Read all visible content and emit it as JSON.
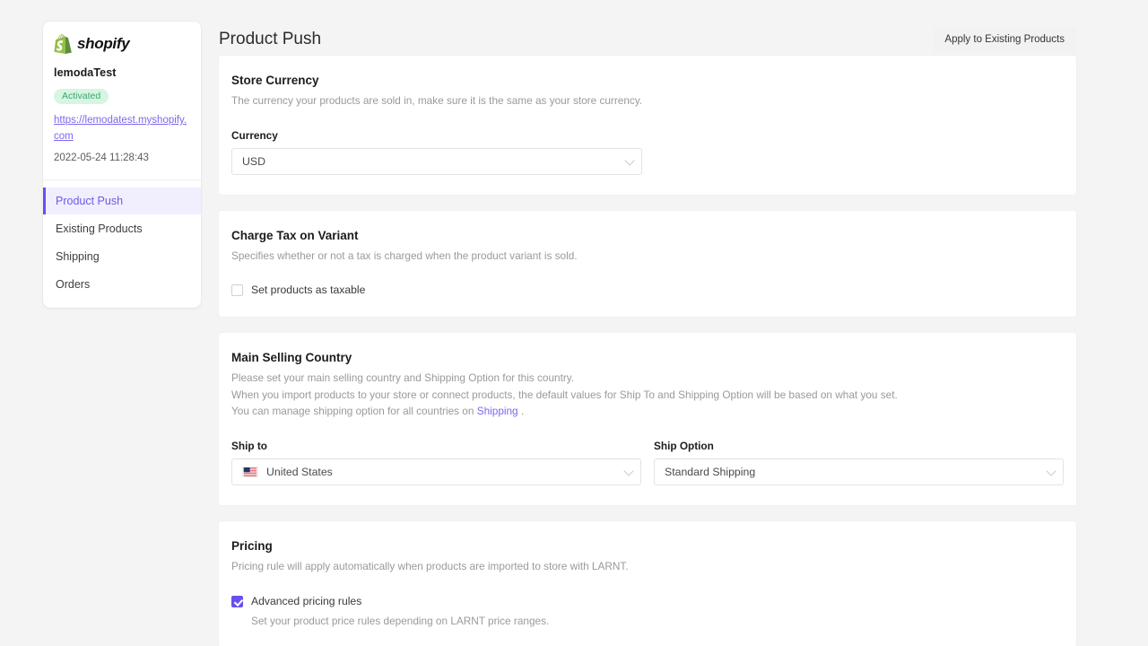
{
  "sidebar": {
    "logo_text": "shopify",
    "logo_icon": "shopify-bag-icon",
    "store_name": "lemodaTest",
    "status_badge": "Activated",
    "store_url": "https://lemodatest.myshopify.com",
    "timestamp": "2022-05-24 11:28:43",
    "nav_items": [
      {
        "label": "Product Push",
        "active": true
      },
      {
        "label": "Existing Products",
        "active": false
      },
      {
        "label": "Shipping",
        "active": false
      },
      {
        "label": "Orders",
        "active": false
      }
    ]
  },
  "header": {
    "title": "Product Push",
    "apply_button": "Apply to Existing Products"
  },
  "cards": {
    "store_currency": {
      "title": "Store Currency",
      "description": "The currency your products are sold in, make sure it is the same as your store currency.",
      "field_label": "Currency",
      "value": "USD"
    },
    "charge_tax": {
      "title": "Charge Tax on Variant",
      "description": "Specifies whether or not a tax is charged when the product variant is sold.",
      "checkbox_label": "Set products as taxable",
      "checked": false
    },
    "main_selling_country": {
      "title": "Main Selling Country",
      "description_line1": "Please set your main selling country and Shipping Option for this country.",
      "description_line2": "When you import products to your store or connect products, the default values for Ship To and Shipping Option will be based on what you set.",
      "description_line3_pre": "You can manage shipping option for all countries on ",
      "description_link": "Shipping",
      "description_line3_post": " .",
      "ship_to_label": "Ship to",
      "ship_to_value": "United States",
      "ship_to_flag": "us-flag-icon",
      "ship_option_label": "Ship Option",
      "ship_option_value": "Standard Shipping"
    },
    "pricing": {
      "title": "Pricing",
      "description": "Pricing rule will apply automatically when products are imported to store with LARNT.",
      "checkbox_label": "Advanced pricing rules",
      "checked": true,
      "sub_description": "Set your product price rules depending on LARNT price ranges."
    }
  },
  "colors": {
    "accent_purple": "#6b4ef0",
    "link_purple": "#7b68ee",
    "badge_green": "#3aa86b",
    "shopify_green": "#95bf47",
    "page_bg": "#f4f4f4"
  }
}
